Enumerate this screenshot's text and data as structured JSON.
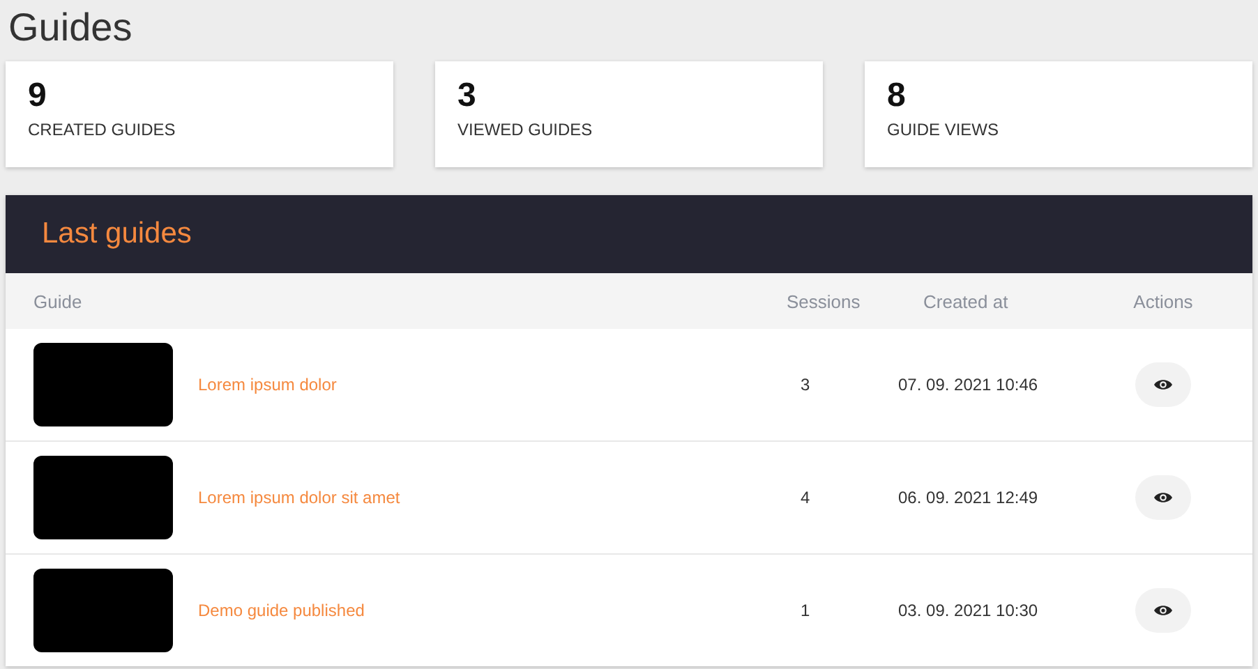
{
  "page_title": "Guides",
  "stats": [
    {
      "value": "9",
      "label": "CREATED GUIDES"
    },
    {
      "value": "3",
      "label": "VIEWED GUIDES"
    },
    {
      "value": "8",
      "label": "GUIDE VIEWS"
    }
  ],
  "panel": {
    "title": "Last guides",
    "columns": [
      "Guide",
      "Sessions",
      "Created at",
      "Actions"
    ],
    "rows": [
      {
        "name": "Lorem ipsum dolor",
        "sessions": "3",
        "created_at": "07. 09. 2021 10:46"
      },
      {
        "name": "Lorem ipsum dolor sit amet",
        "sessions": "4",
        "created_at": "06. 09. 2021 12:49"
      },
      {
        "name": "Demo guide published",
        "sessions": "1",
        "created_at": "03. 09. 2021 10:30"
      }
    ]
  }
}
